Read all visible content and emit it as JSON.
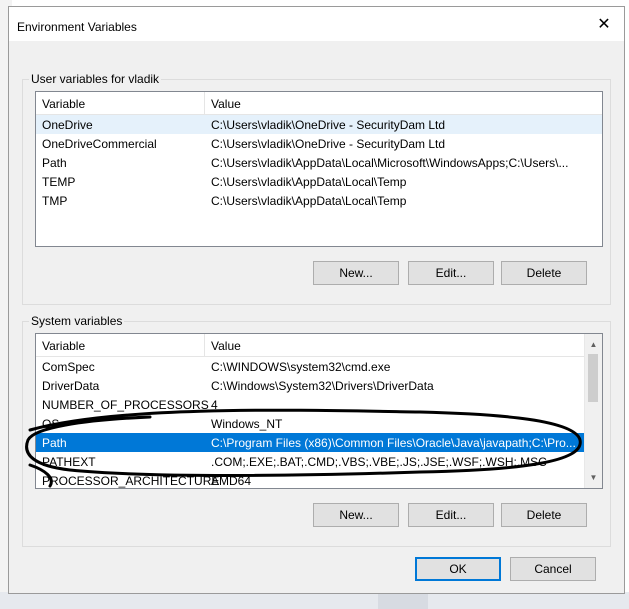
{
  "window": {
    "title": "Environment Variables"
  },
  "user_vars": {
    "label": "User variables for vladik",
    "columns": [
      "Variable",
      "Value"
    ],
    "rows": [
      {
        "variable": "OneDrive",
        "value": "C:\\Users\\vladik\\OneDrive - SecurityDam Ltd"
      },
      {
        "variable": "OneDriveCommercial",
        "value": "C:\\Users\\vladik\\OneDrive - SecurityDam Ltd"
      },
      {
        "variable": "Path",
        "value": "C:\\Users\\vladik\\AppData\\Local\\Microsoft\\WindowsApps;C:\\Users\\..."
      },
      {
        "variable": "TEMP",
        "value": "C:\\Users\\vladik\\AppData\\Local\\Temp"
      },
      {
        "variable": "TMP",
        "value": "C:\\Users\\vladik\\AppData\\Local\\Temp"
      }
    ],
    "buttons": {
      "new": "New...",
      "edit": "Edit...",
      "delete": "Delete"
    }
  },
  "system_vars": {
    "label": "System variables",
    "columns": [
      "Variable",
      "Value"
    ],
    "rows": [
      {
        "variable": "ComSpec",
        "value": "C:\\WINDOWS\\system32\\cmd.exe"
      },
      {
        "variable": "DriverData",
        "value": "C:\\Windows\\System32\\Drivers\\DriverData"
      },
      {
        "variable": "NUMBER_OF_PROCESSORS",
        "value": "4"
      },
      {
        "variable": "OS",
        "value": "Windows_NT"
      },
      {
        "variable": "Path",
        "value": "C:\\Program Files (x86)\\Common Files\\Oracle\\Java\\javapath;C:\\Pro..."
      },
      {
        "variable": "PATHEXT",
        "value": ".COM;.EXE;.BAT;.CMD;.VBS;.VBE;.JS;.JSE;.WSF;.WSH;.MSC"
      },
      {
        "variable": "PROCESSOR_ARCHITECTURE",
        "value": "AMD64"
      }
    ],
    "selected_index": 4,
    "buttons": {
      "new": "New...",
      "edit": "Edit...",
      "delete": "Delete"
    }
  },
  "footer": {
    "ok": "OK",
    "cancel": "Cancel"
  },
  "colors": {
    "selection": "#0078d7",
    "dialog_bg": "#f0f0f0",
    "annotation": "#000000"
  },
  "icons": {
    "close": "close-icon",
    "scroll_up": "chevron-up-icon",
    "scroll_down": "chevron-down-icon"
  }
}
